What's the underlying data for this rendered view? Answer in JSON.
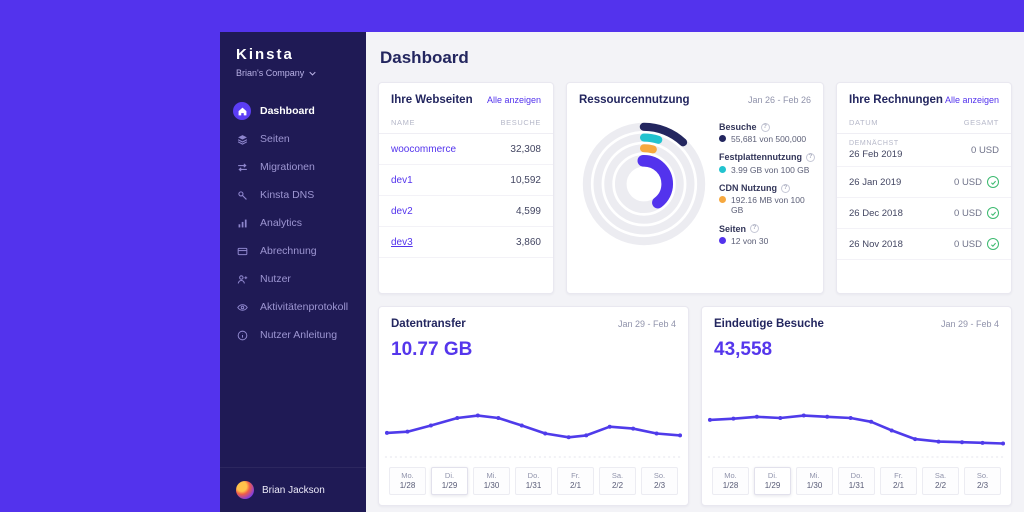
{
  "brand": {
    "logo": "Kinsta",
    "company": "Brian's Company"
  },
  "sidebar": {
    "items": [
      {
        "label": "Dashboard",
        "icon": "home",
        "active": true
      },
      {
        "label": "Seiten",
        "icon": "layers",
        "active": false
      },
      {
        "label": "Migrationen",
        "icon": "migrate",
        "active": false
      },
      {
        "label": "Kinsta DNS",
        "icon": "dns",
        "active": false
      },
      {
        "label": "Analytics",
        "icon": "analytics",
        "active": false
      },
      {
        "label": "Abrechnung",
        "icon": "billing",
        "active": false
      },
      {
        "label": "Nutzer",
        "icon": "users",
        "active": false
      },
      {
        "label": "Aktivitätenprotokoll",
        "icon": "activity",
        "active": false
      },
      {
        "label": "Nutzer Anleitung",
        "icon": "guide",
        "active": false
      }
    ],
    "user": {
      "name": "Brian Jackson"
    }
  },
  "header": {
    "title": "Dashboard"
  },
  "websites": {
    "title": "Ihre Webseiten",
    "action": "Alle anzeigen",
    "columns": [
      "NAME",
      "BESUCHE"
    ],
    "rows": [
      {
        "name": "woocommerce",
        "visits": "32,308",
        "underline": false
      },
      {
        "name": "dev1",
        "visits": "10,592",
        "underline": false
      },
      {
        "name": "dev2",
        "visits": "4,599",
        "underline": false
      },
      {
        "name": "dev3",
        "visits": "3,860",
        "underline": true
      }
    ]
  },
  "resources": {
    "title": "Ressourcennutzung",
    "date_range": "Jan 26 - Feb 26",
    "legend": [
      {
        "label": "Besuche",
        "value": "55,681 von 500,000",
        "color": "#23265f",
        "pct": 12
      },
      {
        "label": "Festplattennutzung",
        "value": "3.99 GB von 100 GB",
        "color": "#22c3cf",
        "pct": 5
      },
      {
        "label": "CDN Nutzung",
        "value": "192.16 MB von 100 GB",
        "color": "#f6a83f",
        "pct": 4
      },
      {
        "label": "Seiten",
        "value": "12 von 30",
        "color": "#5333ed",
        "pct": 40
      }
    ]
  },
  "invoices": {
    "title": "Ihre Rechnungen",
    "action": "Alle anzeigen",
    "columns": [
      "DATUM",
      "GESAMT"
    ],
    "rows": [
      {
        "tag": "DEMNÄCHST",
        "date": "26 Feb 2019",
        "amount": "0 USD",
        "paid": false
      },
      {
        "tag": "",
        "date": "26 Jan 2019",
        "amount": "0 USD",
        "paid": true
      },
      {
        "tag": "",
        "date": "26 Dec 2018",
        "amount": "0 USD",
        "paid": true
      },
      {
        "tag": "",
        "date": "26 Nov 2018",
        "amount": "0 USD",
        "paid": true
      }
    ]
  },
  "charts": {
    "transfer": {
      "title": "Datentransfer",
      "date_range": "Jan 29 - Feb 4",
      "value": "10.77 GB"
    },
    "visits": {
      "title": "Eindeutige Besuche",
      "date_range": "Jan 29 - Feb 4",
      "value": "43,558"
    }
  },
  "axis_labels": [
    {
      "day": "Mo.",
      "date": "1/28"
    },
    {
      "day": "Di.",
      "date": "1/29"
    },
    {
      "day": "Mi.",
      "date": "1/30"
    },
    {
      "day": "Do.",
      "date": "1/31"
    },
    {
      "day": "Fr.",
      "date": "2/1"
    },
    {
      "day": "Sa.",
      "date": "2/2"
    },
    {
      "day": "So.",
      "date": "2/3"
    }
  ],
  "chart_data": [
    {
      "type": "line",
      "title": "Datentransfer",
      "total": "10.77 GB",
      "x_labels": [
        "Mo. 1/28",
        "Di. 1/29",
        "Mi. 1/30",
        "Do. 1/31",
        "Fr. 2/1",
        "Sa. 2/2",
        "So. 2/3"
      ],
      "line_color": "#4f3bea",
      "points": [
        [
          0,
          0.34
        ],
        [
          0.07,
          0.36
        ],
        [
          0.15,
          0.46
        ],
        [
          0.24,
          0.58
        ],
        [
          0.31,
          0.62
        ],
        [
          0.38,
          0.58
        ],
        [
          0.46,
          0.46
        ],
        [
          0.54,
          0.33
        ],
        [
          0.62,
          0.27
        ],
        [
          0.68,
          0.3
        ],
        [
          0.76,
          0.44
        ],
        [
          0.84,
          0.41
        ],
        [
          0.92,
          0.33
        ],
        [
          1,
          0.3
        ]
      ]
    },
    {
      "type": "line",
      "title": "Eindeutige Besuche",
      "total": "43,558",
      "x_labels": [
        "Mo. 1/28",
        "Di. 1/29",
        "Mi. 1/30",
        "Do. 1/31",
        "Fr. 2/1",
        "Sa. 2/2",
        "So. 2/3"
      ],
      "line_color": "#4f3bea",
      "points": [
        [
          0,
          0.55
        ],
        [
          0.08,
          0.57
        ],
        [
          0.16,
          0.6
        ],
        [
          0.24,
          0.58
        ],
        [
          0.32,
          0.62
        ],
        [
          0.4,
          0.6
        ],
        [
          0.48,
          0.58
        ],
        [
          0.55,
          0.52
        ],
        [
          0.62,
          0.38
        ],
        [
          0.7,
          0.24
        ],
        [
          0.78,
          0.2
        ],
        [
          0.86,
          0.19
        ],
        [
          0.93,
          0.18
        ],
        [
          1,
          0.17
        ]
      ]
    },
    {
      "type": "donut",
      "title": "Ressourcennutzung",
      "series": [
        {
          "name": "Besuche",
          "label": "55,681 von 500,000",
          "pct": 12,
          "color": "#23265f"
        },
        {
          "name": "Festplattennutzung",
          "label": "3.99 GB von 100 GB",
          "pct": 5,
          "color": "#22c3cf"
        },
        {
          "name": "CDN Nutzung",
          "label": "192.16 MB von 100 GB",
          "pct": 4,
          "color": "#f6a83f"
        },
        {
          "name": "Seiten",
          "label": "12 von 30",
          "pct": 40,
          "color": "#5333ed"
        }
      ]
    }
  ]
}
